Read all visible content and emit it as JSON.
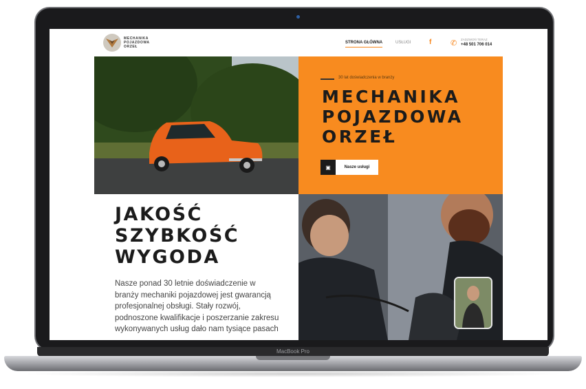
{
  "device": {
    "label": "MacBook Pro"
  },
  "site": {
    "logo_text": [
      "MECHANIKA",
      "POJAZDOWA",
      "ORZEŁ"
    ],
    "nav": {
      "home": "STRONA GŁÓWNA",
      "services": "USŁUGI"
    },
    "social_icon": "facebook-icon",
    "contact": {
      "label": "ZADZWOŃ TERAZ",
      "phone": "+48 501 706 014"
    },
    "hero": {
      "experience": "30 lat doświadczenia w branży",
      "title_lines": [
        "MECHANIKA",
        "POJAZDOWA",
        "ORZEŁ"
      ],
      "button_label": "Nasze usługi"
    },
    "section": {
      "heading_lines": [
        "JAKOŚĆ",
        "SZYBKOŚĆ",
        "WYGODA"
      ],
      "paragraph": "Nasze ponad 30 letnie doświadczenie w branży mechaniki pojazdowej jest gwarancją profesjonalnej obsługi. Stały rozwój, podnoszone kwalifikacje i poszerzanie zakresu wykonywanych usług dało nam tysiące pasach"
    },
    "colors": {
      "accent": "#f88b1f",
      "dark": "#1b1b1b"
    }
  }
}
